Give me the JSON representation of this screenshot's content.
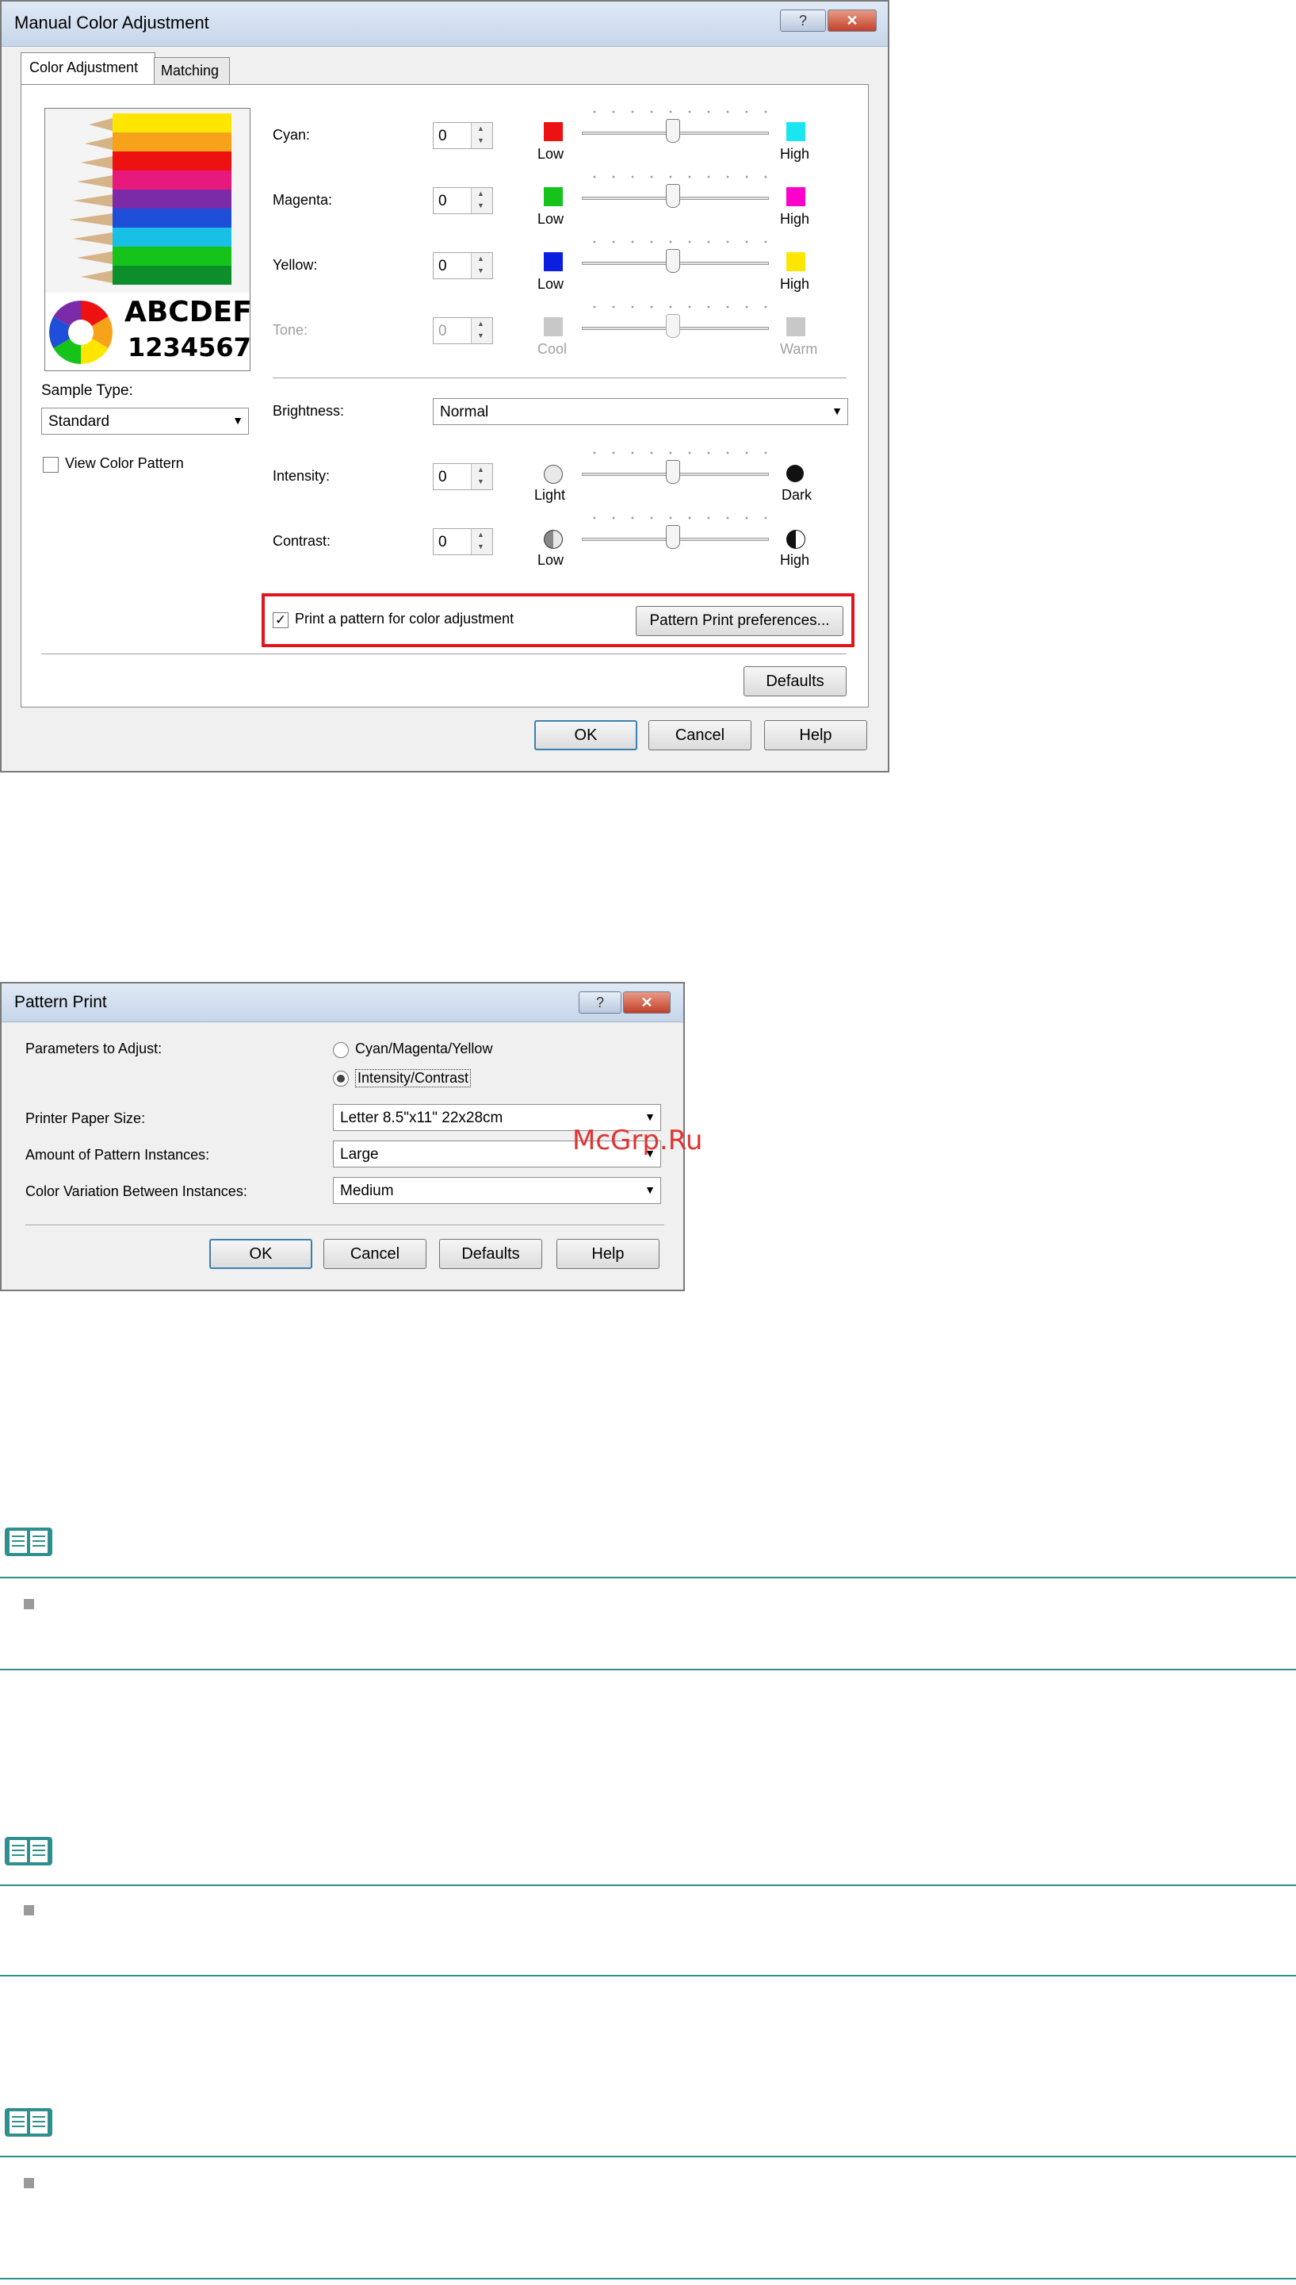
{
  "mca": {
    "title": "Manual Color Adjustment",
    "tab_color_adjustment": "Color Adjustment",
    "tab_matching": "Matching",
    "preview_text1": "ABCDEF",
    "preview_text2": "1234567",
    "sample_type_label": "Sample Type:",
    "sample_type_value": "Standard",
    "view_color_pattern": "View Color Pattern",
    "cyan_label": "Cyan:",
    "cyan_value": "0",
    "magenta_label": "Magenta:",
    "magenta_value": "0",
    "yellow_label": "Yellow:",
    "yellow_value": "0",
    "tone_label": "Tone:",
    "tone_value": "0",
    "low": "Low",
    "high": "High",
    "cool": "Cool",
    "warm": "Warm",
    "light": "Light",
    "dark": "Dark",
    "brightness_label": "Brightness:",
    "brightness_value": "Normal",
    "intensity_label": "Intensity:",
    "intensity_value": "0",
    "contrast_label": "Contrast:",
    "contrast_value": "0",
    "print_pattern_label": "Print a pattern for color adjustment",
    "pattern_prefs_button": "Pattern Print preferences...",
    "defaults_button": "Defaults",
    "ok_button": "OK",
    "cancel_button": "Cancel",
    "help_button": "Help",
    "help_glyph": "?",
    "close_glyph": "✕"
  },
  "pp": {
    "title": "Pattern Print",
    "params_label": "Parameters to Adjust:",
    "option_cmy": "Cyan/Magenta/Yellow",
    "option_ic": "Intensity/Contrast",
    "paper_size_label": "Printer Paper Size:",
    "paper_size_value": "Letter 8.5\"x11\" 22x28cm",
    "instances_label": "Amount of Pattern Instances:",
    "instances_value": "Large",
    "variation_label": "Color Variation Between Instances:",
    "variation_value": "Medium",
    "ok_button": "OK",
    "cancel_button": "Cancel",
    "defaults_button": "Defaults",
    "help_button": "Help",
    "help_glyph": "?",
    "close_glyph": "✕"
  },
  "watermark": "McGrp.Ru",
  "colors": {
    "cyan": "#19e6f0",
    "magenta": "#ff00cc",
    "yellow": "#ffe600",
    "red": "#ee1111",
    "green": "#16c31b",
    "blue": "#0a1fe0",
    "highlight": "#e0161c",
    "note_rule": "#2f8f8f"
  },
  "icons": [
    "help-icon",
    "close-icon",
    "spin-arrows-icon",
    "dropdown-arrow-icon",
    "book-note-icon",
    "bullet-icon"
  ]
}
